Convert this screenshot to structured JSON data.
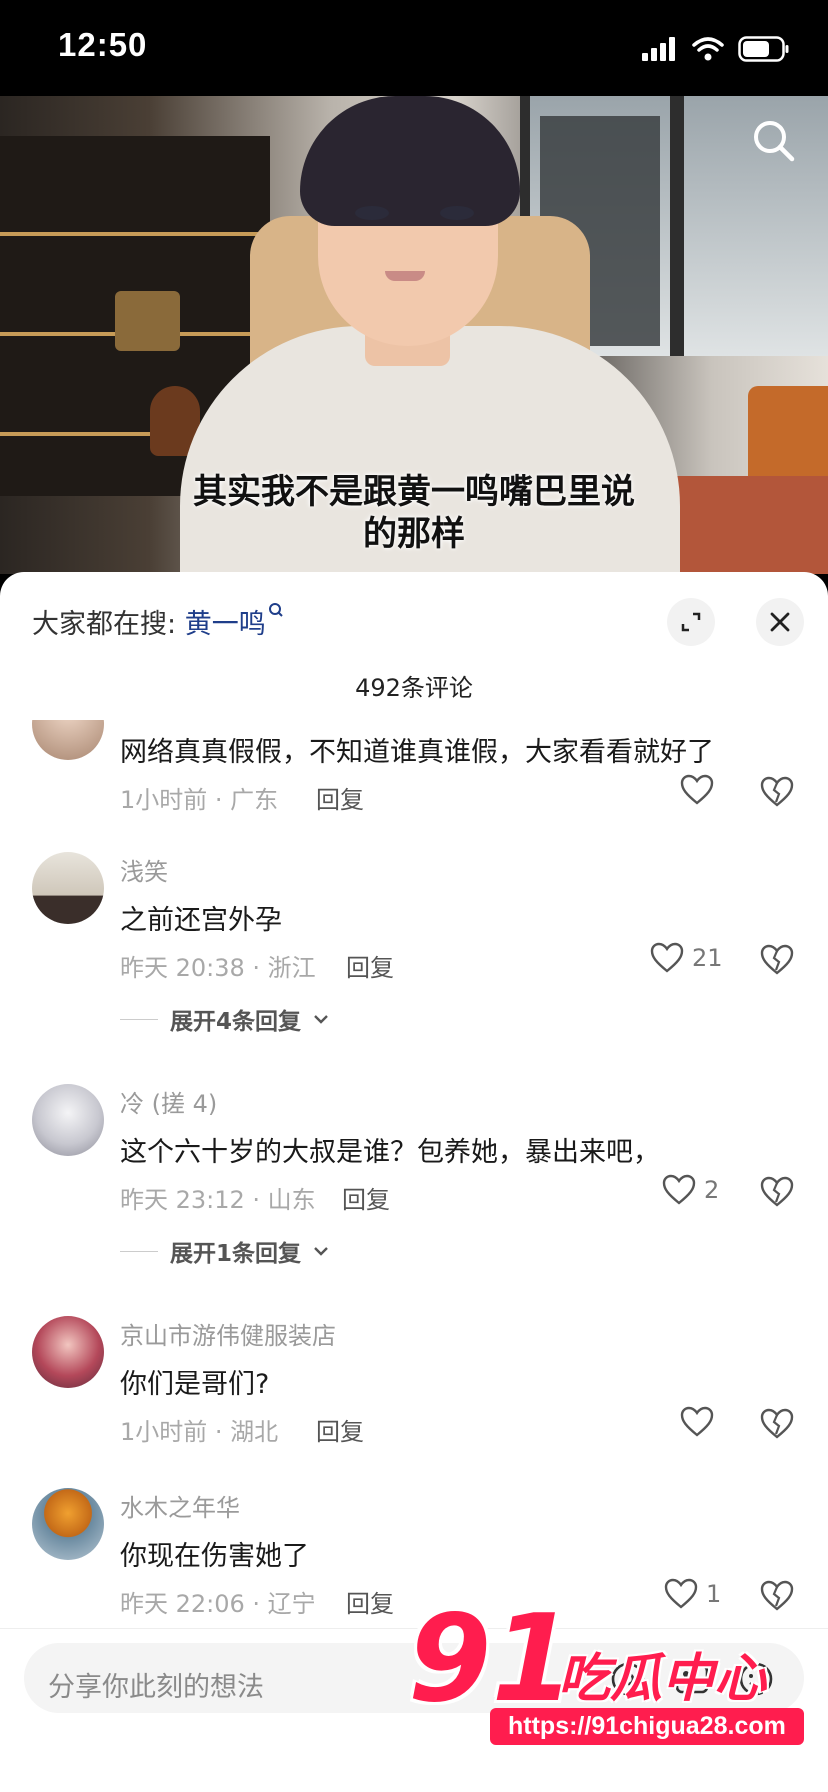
{
  "status_bar": {
    "time": "12:50"
  },
  "video": {
    "subtitle_line1": "其实我不是跟黄一鸣嘴巴里说",
    "subtitle_line2": "的那样"
  },
  "sheet": {
    "search_prefix": "大家都在搜:",
    "search_keyword": "黄一鸣",
    "comment_count": "492条评论"
  },
  "comments": [
    {
      "name": "",
      "text": "网络真真假假，不知道谁真谁假，大家看看就好了",
      "meta": "1小时前 · 广东",
      "reply": "回复",
      "likes": ""
    },
    {
      "name": "浅笑",
      "text": "之前还宫外孕",
      "meta": "昨天 20:38 · 浙江",
      "reply": "回复",
      "likes": "21",
      "expand": "展开4条回复"
    },
    {
      "name": "冷 (搓 4)",
      "text": "这个六十岁的大叔是谁？包养她，暴出来吧，",
      "meta": "昨天 23:12 · 山东",
      "reply": "回复",
      "likes": "2",
      "expand": "展开1条回复"
    },
    {
      "name": "京山市游伟健服装店",
      "text": "你们是哥们?",
      "meta": "1小时前 · 湖北",
      "reply": "回复",
      "likes": ""
    },
    {
      "name": "水木之年华",
      "text": "你现在伤害她了",
      "meta": "昨天 22:06 · 辽宁",
      "reply": "回复",
      "likes": "1"
    }
  ],
  "input": {
    "placeholder": "分享你此刻的想法"
  },
  "watermark": {
    "big": "91",
    "text": "吃瓜中心",
    "url": "https://91chigua28.com"
  },
  "colors": {
    "accent_keyword": "#1f3e8a",
    "watermark": "#ff1d4e"
  },
  "icons": [
    "signal-icon",
    "wifi-icon",
    "battery-icon",
    "search-icon",
    "expand-icon",
    "close-icon",
    "heart-icon",
    "broken-heart-icon",
    "at-icon",
    "image-icon",
    "emoji-icon"
  ]
}
